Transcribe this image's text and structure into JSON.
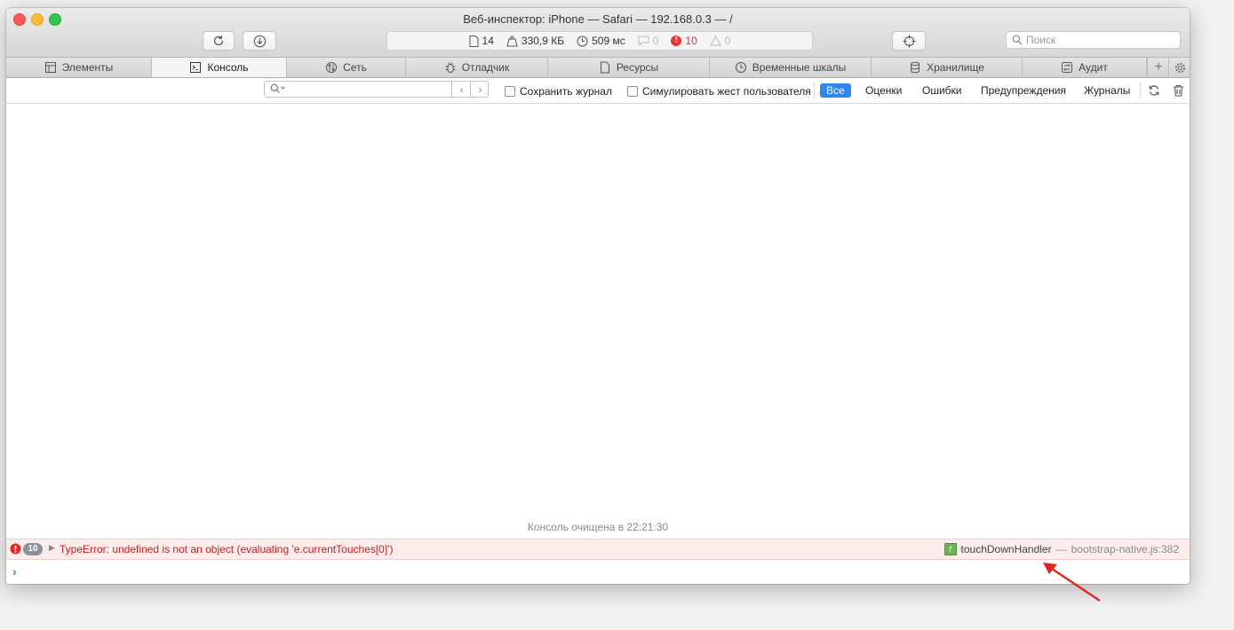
{
  "window": {
    "title": "Веб-инспектор: iPhone — Safari — 192.168.0.3 — /"
  },
  "toolbar": {
    "reload_icon": "reload-icon",
    "download_icon": "download-icon",
    "inspect_icon": "crosshair-icon",
    "activity": {
      "resources": "14",
      "size": "330,9 КБ",
      "time": "509 мс",
      "logs": "0",
      "errors": "10",
      "warnings": "0"
    },
    "search_placeholder": "Поиск"
  },
  "tabs": [
    {
      "label": "Элементы",
      "icon": "elements-icon"
    },
    {
      "label": "Консоль",
      "icon": "console-icon"
    },
    {
      "label": "Сеть",
      "icon": "network-icon"
    },
    {
      "label": "Отладчик",
      "icon": "debugger-icon"
    },
    {
      "label": "Ресурсы",
      "icon": "resources-icon"
    },
    {
      "label": "Временные шкалы",
      "icon": "timelines-icon"
    },
    {
      "label": "Хранилище",
      "icon": "storage-icon"
    },
    {
      "label": "Аудит",
      "icon": "audit-icon"
    }
  ],
  "filter_bar": {
    "preserve_log": "Сохранить журнал",
    "emulate_gesture": "Симулировать жест пользователя",
    "levels": [
      "Все",
      "Оценки",
      "Ошибки",
      "Предупреждения",
      "Журналы"
    ],
    "active_level": "Все"
  },
  "console": {
    "cleared_message": "Консоль очищена в 22:21:30",
    "error": {
      "count": "10",
      "message": "TypeError: undefined is not an object (evaluating 'e.currentTouches[0]')",
      "function": "touchDownHandler",
      "separator": "—",
      "location": "bootstrap-native.js:382"
    }
  },
  "colors": {
    "accent": "#2f86ee",
    "error": "#c81e1e",
    "error_bg": "#fdecec",
    "annotation_arrow": "#e0261c"
  }
}
